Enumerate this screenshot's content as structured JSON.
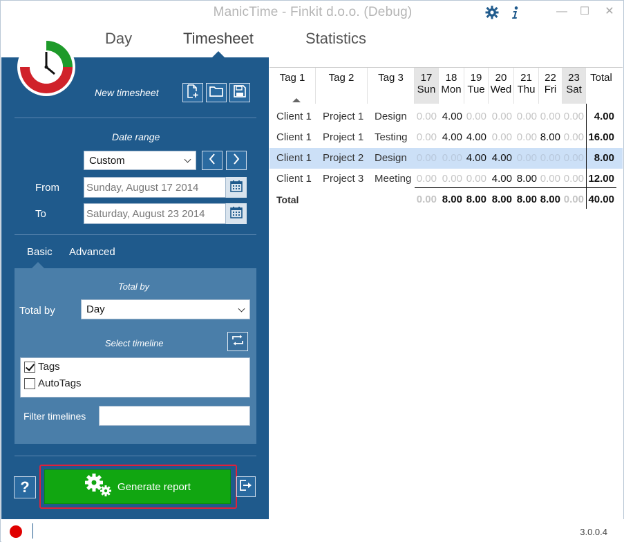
{
  "window": {
    "title": "ManicTime - Finkit d.o.o. (Debug)",
    "accent": "#1f5a8c"
  },
  "nav": {
    "tabs": [
      {
        "label": "Day"
      },
      {
        "label": "Timesheet"
      },
      {
        "label": "Statistics"
      }
    ],
    "active": "Timesheet"
  },
  "toolbar": {
    "title": "New timesheet",
    "icons": [
      "new-file-icon",
      "open-folder-icon",
      "save-icon"
    ]
  },
  "date_range": {
    "label": "Date range",
    "selected": "Custom",
    "from_label": "From",
    "from_value": "Sunday, August 17 2014",
    "to_label": "To",
    "to_value": "Saturday, August 23 2014"
  },
  "options_tabs": {
    "basic": "Basic",
    "advanced": "Advanced"
  },
  "basic": {
    "total_by_header": "Total by",
    "total_by_label": "Total by",
    "total_by_value": "Day",
    "select_timeline_header": "Select timeline",
    "timelines": [
      {
        "label": "Tags",
        "checked": true
      },
      {
        "label": "AutoTags",
        "checked": false
      }
    ],
    "filter_label": "Filter timelines",
    "filter_value": ""
  },
  "actions": {
    "help": "?",
    "generate": "Generate report"
  },
  "status": {
    "version": "3.0.0.4",
    "record_color": "#e00000"
  },
  "grid": {
    "headers": {
      "tag1": "Tag 1",
      "tag2": "Tag 2",
      "tag3": "Tag 3",
      "total": "Total",
      "days": [
        {
          "num": "17",
          "name": "Sun"
        },
        {
          "num": "18",
          "name": "Mon"
        },
        {
          "num": "19",
          "name": "Tue"
        },
        {
          "num": "20",
          "name": "Wed"
        },
        {
          "num": "21",
          "name": "Thu"
        },
        {
          "num": "22",
          "name": "Fri"
        },
        {
          "num": "23",
          "name": "Sat"
        }
      ]
    },
    "rows": [
      {
        "tag1": "Client 1",
        "tag2": "Project 1",
        "tag3": "Design",
        "values": [
          "0.00",
          "4.00",
          "0.00",
          "0.00",
          "0.00",
          "0.00",
          "0.00"
        ],
        "total": "4.00"
      },
      {
        "tag1": "Client 1",
        "tag2": "Project 1",
        "tag3": "Testing",
        "values": [
          "0.00",
          "4.00",
          "4.00",
          "0.00",
          "0.00",
          "8.00",
          "0.00"
        ],
        "total": "16.00"
      },
      {
        "tag1": "Client 1",
        "tag2": "Project 2",
        "tag3": "Design",
        "values": [
          "0.00",
          "0.00",
          "4.00",
          "4.00",
          "0.00",
          "0.00",
          "0.00"
        ],
        "total": "8.00"
      },
      {
        "tag1": "Client 1",
        "tag2": "Project 3",
        "tag3": "Meeting",
        "values": [
          "0.00",
          "0.00",
          "0.00",
          "4.00",
          "8.00",
          "0.00",
          "0.00"
        ],
        "total": "12.00"
      }
    ],
    "totals": {
      "label": "Total",
      "values": [
        "0.00",
        "8.00",
        "8.00",
        "8.00",
        "8.00",
        "8.00",
        "0.00"
      ],
      "total": "40.00"
    }
  }
}
